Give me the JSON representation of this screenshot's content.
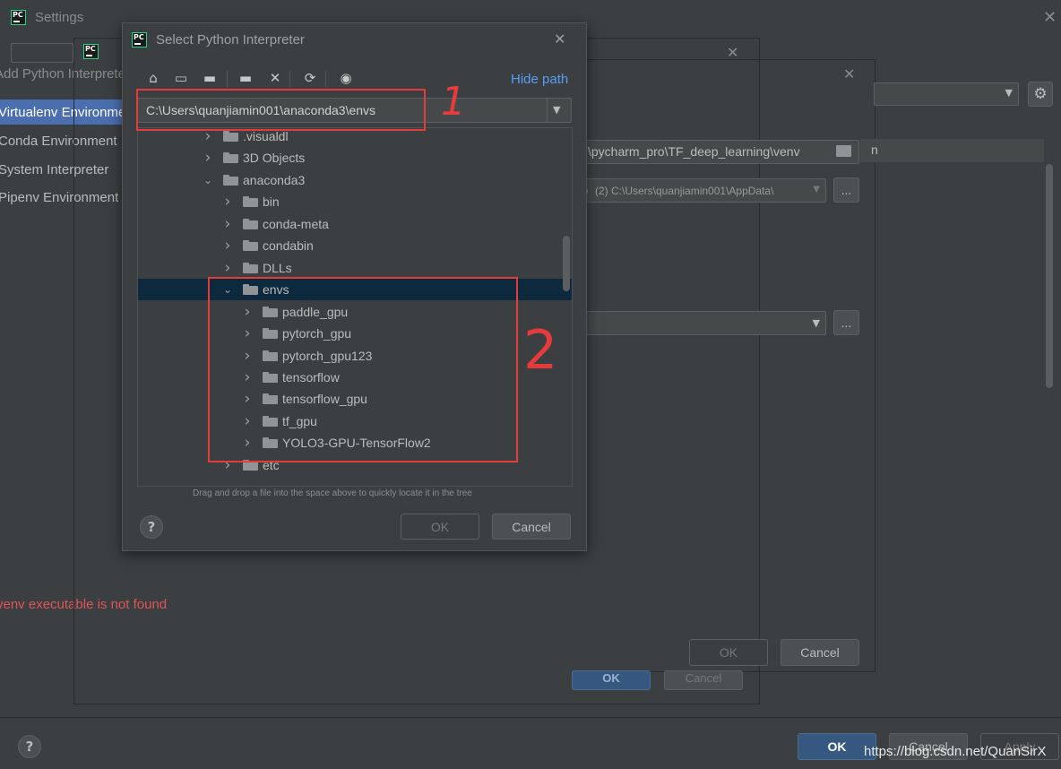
{
  "settings_window": {
    "title": "Settings",
    "left_header": "Add Python Interpreter",
    "sidebar_items": [
      "Virtualenv Environment",
      "Conda Environment",
      "System Interpreter",
      "Pipenv Environment"
    ],
    "error_text": "venv executable is not found",
    "venv_path": "\\pycharm_pro\\TF_deep_learning\\venv",
    "base_interpreter": "(2) C:\\Users\\quanjiamin001\\AppData\\",
    "browse_label": "...",
    "ok_label": "OK",
    "cancel_label": "Cancel",
    "apply_label": "Apply",
    "help_label": "?"
  },
  "dialog": {
    "title": "Select Python Interpreter",
    "hide_path_label": "Hide path",
    "path_value": "C:\\Users\\quanjiamin001\\anaconda3\\envs",
    "hint": "Drag and drop a file into the space above to quickly locate it in the tree",
    "ok_label": "OK",
    "cancel_label": "Cancel",
    "help_label": "?",
    "tree": [
      {
        "label": ".visualdl",
        "level": 0,
        "expanded": false
      },
      {
        "label": "3D Objects",
        "level": 0,
        "expanded": false
      },
      {
        "label": "anaconda3",
        "level": 0,
        "expanded": true
      },
      {
        "label": "bin",
        "level": 1,
        "expanded": false
      },
      {
        "label": "conda-meta",
        "level": 1,
        "expanded": false
      },
      {
        "label": "condabin",
        "level": 1,
        "expanded": false
      },
      {
        "label": "DLLs",
        "level": 1,
        "expanded": false
      },
      {
        "label": "envs",
        "level": 1,
        "expanded": true,
        "selected": true
      },
      {
        "label": "paddle_gpu",
        "level": 2,
        "expanded": false
      },
      {
        "label": "pytorch_gpu",
        "level": 2,
        "expanded": false
      },
      {
        "label": "pytorch_gpu123",
        "level": 2,
        "expanded": false
      },
      {
        "label": "tensorflow",
        "level": 2,
        "expanded": false
      },
      {
        "label": "tensorflow_gpu",
        "level": 2,
        "expanded": false
      },
      {
        "label": "tf_gpu",
        "level": 2,
        "expanded": false
      },
      {
        "label": "YOLO3-GPU-TensorFlow2",
        "level": 2,
        "expanded": false
      },
      {
        "label": "etc",
        "level": 1,
        "expanded": false
      }
    ]
  },
  "annotations": {
    "mark_1": "1",
    "mark_2": "2"
  },
  "watermark": "https://blog.csdn.net/QuanSirX",
  "colors": {
    "accent_link": "#589df6",
    "selection": "#0d293e",
    "error": "#e05555",
    "annotation": "#e63b3b",
    "primary_button": "#365880"
  }
}
